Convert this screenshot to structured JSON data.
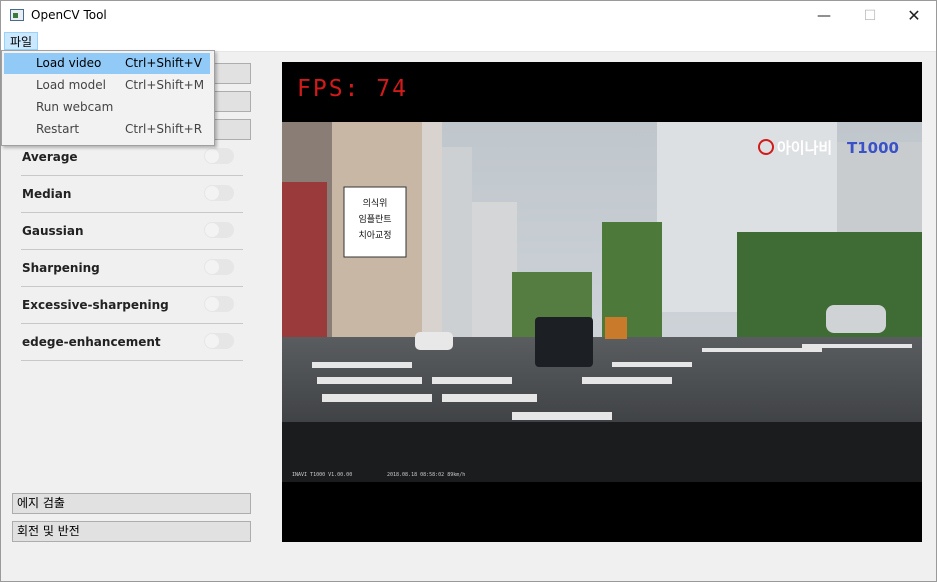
{
  "window": {
    "title": "OpenCV Tool",
    "controls": [
      "—",
      "☐",
      "✕"
    ]
  },
  "menubar": {
    "file_menu": "파일"
  },
  "file_menu": {
    "items": [
      {
        "label": "Load video",
        "shortcut": "Ctrl+Shift+V",
        "highlighted": true
      },
      {
        "label": "Load model",
        "shortcut": "Ctrl+Shift+M",
        "highlighted": false
      },
      {
        "label": "Run webcam",
        "shortcut": "",
        "highlighted": false
      },
      {
        "label": "Restart",
        "shortcut": "Ctrl+Shift+R",
        "highlighted": false
      }
    ]
  },
  "filters": {
    "items": [
      {
        "label": "Average",
        "enabled": false
      },
      {
        "label": "Median",
        "enabled": false
      },
      {
        "label": "Gaussian",
        "enabled": false
      },
      {
        "label": "Sharpening",
        "enabled": false
      },
      {
        "label": "Excessive-sharpening",
        "enabled": false
      },
      {
        "label": "edege-enhancement",
        "enabled": false
      }
    ]
  },
  "group_buttons": {
    "edge_detection": "에지 검출",
    "rotate_flip": "회전 및 반전"
  },
  "video": {
    "fps_text": "FPS: 74",
    "overlay_brand": "아이나비",
    "overlay_model": "T1000",
    "overlay_left_text": "INAVI T1000  V1.00.00",
    "overlay_timestamp": "2018.08.18 08:58:02   89km/h",
    "sign_lines": [
      "의식위",
      "임플란트",
      "치아교정"
    ]
  },
  "colors": {
    "fps": "#d21a1a",
    "menu_highlight": "#91c9f7",
    "menu_active": "#cce8ff",
    "video_bg": "#000000"
  }
}
